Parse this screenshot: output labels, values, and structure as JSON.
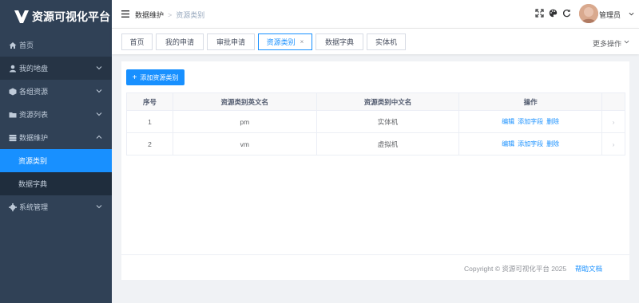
{
  "app": {
    "title": "资源可视化平台"
  },
  "sidebar": {
    "items": [
      {
        "label": "首页",
        "icon": "home-icon"
      },
      {
        "label": "我的地盘",
        "icon": "user-icon"
      },
      {
        "label": "各组资源",
        "icon": "cube-icon"
      },
      {
        "label": "资源列表",
        "icon": "folder-icon"
      },
      {
        "label": "数据维护",
        "icon": "database-icon"
      },
      {
        "label": "系统管理",
        "icon": "gear-icon"
      }
    ],
    "sub_items": [
      {
        "label": "资源类别"
      },
      {
        "label": "数据字典"
      }
    ]
  },
  "header": {
    "breadcrumb": [
      "数据维护",
      "资源类别"
    ],
    "user_name": "管理员"
  },
  "tags": {
    "items": [
      "首页",
      "我的申请",
      "审批申请",
      "资源类别",
      "数据字典",
      "实体机"
    ],
    "close_glyph": "×",
    "more_label": "更多操作"
  },
  "toolbar": {
    "add_label": "添加资源类别",
    "add_glyph": "+"
  },
  "table": {
    "columns": [
      "序号",
      "资源类别英文名",
      "资源类别中文名",
      "操作"
    ],
    "rows": [
      {
        "index": "1",
        "en": "pm",
        "zh": "实体机"
      },
      {
        "index": "2",
        "en": "vm",
        "zh": "虚拟机"
      }
    ],
    "ops": [
      "编辑",
      "添加字段",
      "删除"
    ],
    "arrow_glyph": "›"
  },
  "footer": {
    "copyright": "Copyright © 资源可视化平台 2025",
    "help_label": "帮助文档"
  },
  "colors": {
    "accent": "#1890ff",
    "sidebar_bg": "#304156",
    "sidebar_active": "#1890ff"
  }
}
